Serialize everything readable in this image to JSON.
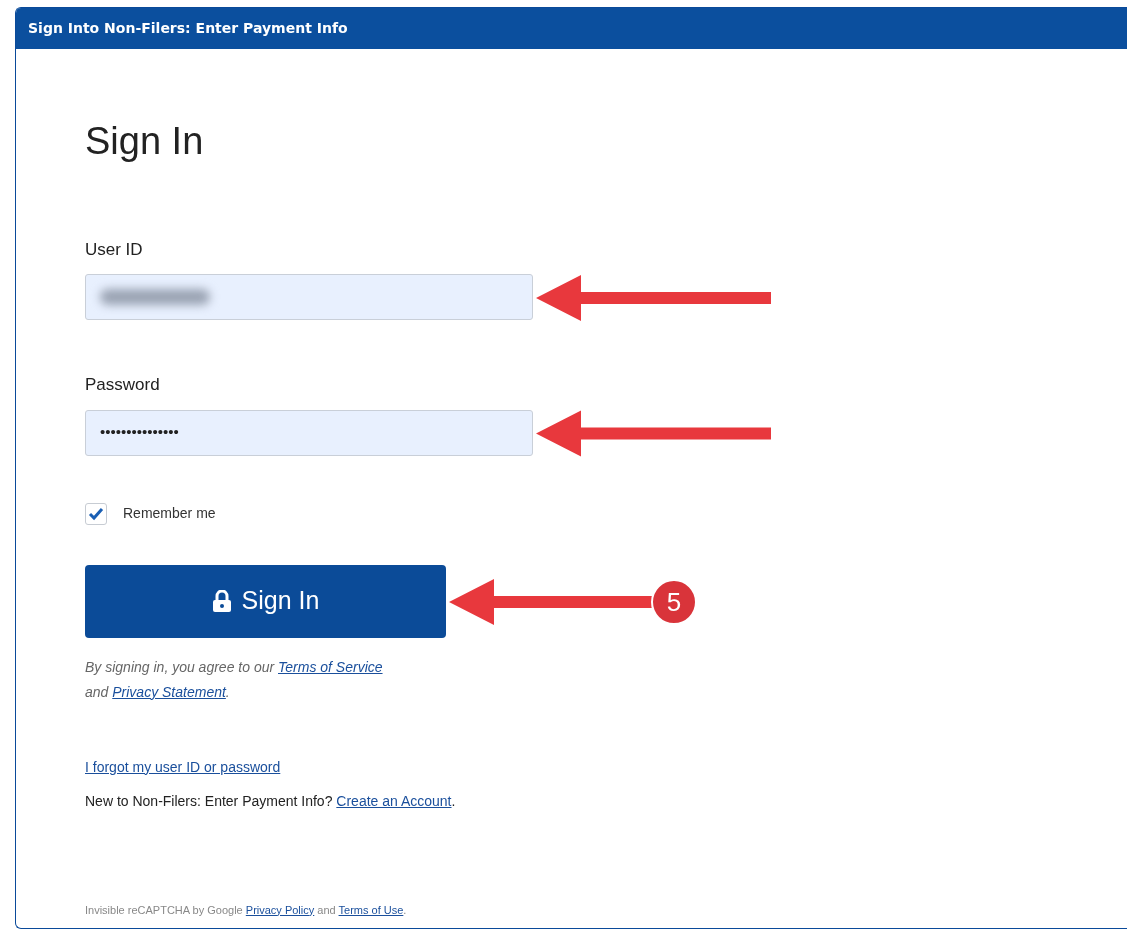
{
  "panel": {
    "title": "Sign Into Non-Filers: Enter Payment Info"
  },
  "heading": "Sign In",
  "fields": [
    {
      "label": "User ID",
      "kind": "blurred",
      "arrow": true
    },
    {
      "label": "Password",
      "kind": "text",
      "value": "•••••••••••••••",
      "arrow": true
    }
  ],
  "remember": {
    "label": "Remember me",
    "checked": true
  },
  "sign_in_button": {
    "label": "Sign In",
    "arrow": true,
    "callout": "5"
  },
  "agreement": [
    {
      "kind": "text",
      "text": "By signing in, you agree to our "
    },
    {
      "kind": "link",
      "text": "Terms of Service"
    },
    {
      "kind": "break"
    },
    {
      "kind": "text",
      "text": "and "
    },
    {
      "kind": "link",
      "text": "Privacy Statement"
    },
    {
      "kind": "text",
      "text": "."
    }
  ],
  "forgot_link": "I forgot my user ID or password",
  "new_account": {
    "text": "New to Non-Filers: Enter Payment Info? ",
    "link": "Create an Account",
    "end": "."
  },
  "recaptcha": {
    "text": "Invisible reCAPTCHA by Google ",
    "link1": "Privacy Policy",
    "middle": " and ",
    "link2": "Terms of Use",
    "end": "."
  }
}
